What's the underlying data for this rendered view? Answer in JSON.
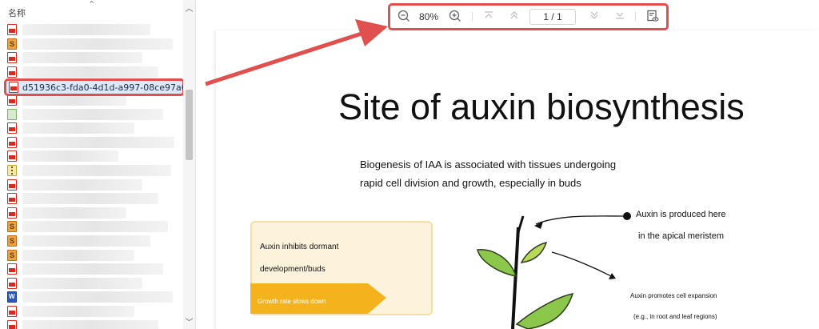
{
  "file_panel": {
    "column_header": "名称",
    "selected_file": "d51936c3-fda0-4d1d-a997-08ce97a6...",
    "rows": [
      {
        "type": "pdf",
        "blur": "160"
      },
      {
        "type": "sub",
        "blur": "188"
      },
      {
        "type": "pdf",
        "blur": "150"
      },
      {
        "type": "pdf",
        "blur": "170"
      },
      {
        "type": "pdf",
        "blur": "0"
      },
      {
        "type": "pdf",
        "blur": "130"
      },
      {
        "type": "img",
        "blur": "176"
      },
      {
        "type": "pdf",
        "blur": "140"
      },
      {
        "type": "pdf",
        "blur": "190"
      },
      {
        "type": "pdf",
        "blur": "120"
      },
      {
        "type": "zip",
        "blur": "186"
      },
      {
        "type": "pdf",
        "blur": "150"
      },
      {
        "type": "pdf",
        "blur": "170"
      },
      {
        "type": "pdf",
        "blur": "130"
      },
      {
        "type": "sub",
        "blur": "182"
      },
      {
        "type": "sub",
        "blur": "160"
      },
      {
        "type": "sub",
        "blur": "140"
      },
      {
        "type": "pdf",
        "blur": "176"
      },
      {
        "type": "pdf",
        "blur": "150"
      },
      {
        "type": "doc",
        "blur": "188"
      },
      {
        "type": "pdf",
        "blur": "140"
      },
      {
        "type": "pdf",
        "blur": "170"
      }
    ]
  },
  "toolbar": {
    "zoom": "80%",
    "page_indicator": "1 / 1"
  },
  "document": {
    "title": "Site of auxin biosynthesis",
    "line1": "Biogenesis of IAA is associated with tissues undergoing",
    "line2": "rapid cell division and growth, especially in buds",
    "produced1": "Auxin is produced here",
    "produced2": "in the apical meristem",
    "inhibits1": "Auxin inhibits dormant",
    "inhibits2": "development/buds",
    "growth_label": "Growth rate slows down",
    "promotes1": "Auxin promotes cell expansion",
    "promotes2": "(e.g., in root and leaf regions)"
  },
  "colors": {
    "highlight": "#e0504f",
    "callout_fill": "#fdf3dc",
    "tag_orange": "#f4b31c",
    "leaf_green": "#8ac74a"
  }
}
